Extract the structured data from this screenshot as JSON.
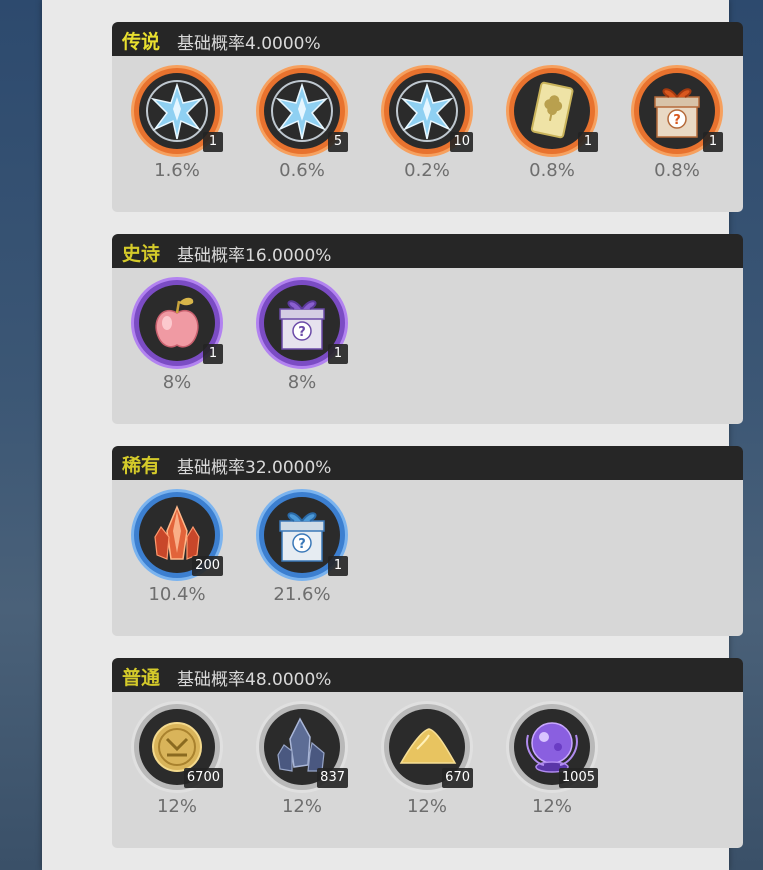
{
  "colors": {
    "legendary": "#e8df2f",
    "epic": "#d4ca2a",
    "rare": "#d4ca2a",
    "common": "#d4ca2a"
  },
  "sections": [
    {
      "tier": "传说",
      "rate": "基础概率4.0000%",
      "items": [
        {
          "icon": "ice-crystal-icon",
          "qty": "1",
          "pct": "1.6%"
        },
        {
          "icon": "ice-crystal-icon",
          "qty": "5",
          "pct": "0.6%"
        },
        {
          "icon": "ice-crystal-icon",
          "qty": "10",
          "pct": "0.2%"
        },
        {
          "icon": "clover-card-icon",
          "qty": "1",
          "pct": "0.8%"
        },
        {
          "icon": "orange-mystery-gift-icon",
          "qty": "1",
          "pct": "0.8%"
        }
      ]
    },
    {
      "tier": "史诗",
      "rate": "基础概率16.0000%",
      "items": [
        {
          "icon": "pink-apple-icon",
          "qty": "1",
          "pct": "8%"
        },
        {
          "icon": "purple-mystery-gift-icon",
          "qty": "1",
          "pct": "8%"
        }
      ]
    },
    {
      "tier": "稀有",
      "rate": "基础概率32.0000%",
      "items": [
        {
          "icon": "red-crystal-icon",
          "qty": "200",
          "pct": "10.4%"
        },
        {
          "icon": "blue-mystery-gift-icon",
          "qty": "1",
          "pct": "21.6%"
        }
      ]
    },
    {
      "tier": "普通",
      "rate": "基础概率48.0000%",
      "items": [
        {
          "icon": "gold-coin-icon",
          "qty": "6700",
          "pct": "12%"
        },
        {
          "icon": "blue-ore-icon",
          "qty": "837",
          "pct": "12%"
        },
        {
          "icon": "gold-sand-icon",
          "qty": "670",
          "pct": "12%"
        },
        {
          "icon": "purple-orb-icon",
          "qty": "1005",
          "pct": "12%"
        }
      ]
    }
  ]
}
